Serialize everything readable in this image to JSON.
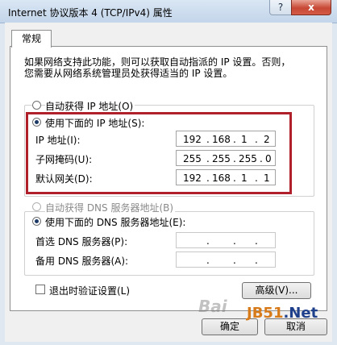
{
  "window": {
    "title": "Internet 协议版本 4 (TCP/IPv4) 属性",
    "help_label": "?",
    "close_label": "x"
  },
  "tabs": [
    "常规"
  ],
  "description": [
    "如果网络支持此功能，则可以获取自动指派的 IP 设置。否则，",
    "您需要从网络系统管理员处获得适当的 IP 设置。"
  ],
  "ip_section": {
    "auto_option": "自动获得 IP 地址(O)",
    "manual_option": "使用下面的 IP 地址(S):",
    "selected": "manual",
    "fields": [
      {
        "label": "IP 地址(I):",
        "octets": [
          "192",
          "168",
          "1",
          "2"
        ]
      },
      {
        "label": "子网掩码(U):",
        "octets": [
          "255",
          "255",
          "255",
          "0"
        ]
      },
      {
        "label": "默认网关(D):",
        "octets": [
          "192",
          "168",
          "1",
          "1"
        ]
      }
    ]
  },
  "dns_section": {
    "auto_option": "自动获得 DNS 服务器地址(B)",
    "manual_option": "使用下面的 DNS 服务器地址(E):",
    "selected": "manual",
    "fields": [
      {
        "label": "首选 DNS 服务器(P):",
        "octets": [
          "",
          "",
          "",
          ""
        ]
      },
      {
        "label": "备用 DNS 服务器(A):",
        "octets": [
          "",
          "",
          "",
          ""
        ]
      }
    ]
  },
  "validate_on_exit": {
    "label": "退出时验证设置(L)",
    "checked": false
  },
  "buttons": {
    "advanced": "高级(V)...",
    "ok": "确定",
    "cancel": "取消"
  },
  "watermark": {
    "site": "JB51",
    "domain": ".Net",
    "brand": "Bai"
  },
  "colors": {
    "highlight_border": "#b0202a",
    "title_bar": "#c3d5ea",
    "close_button": "#c74835"
  }
}
